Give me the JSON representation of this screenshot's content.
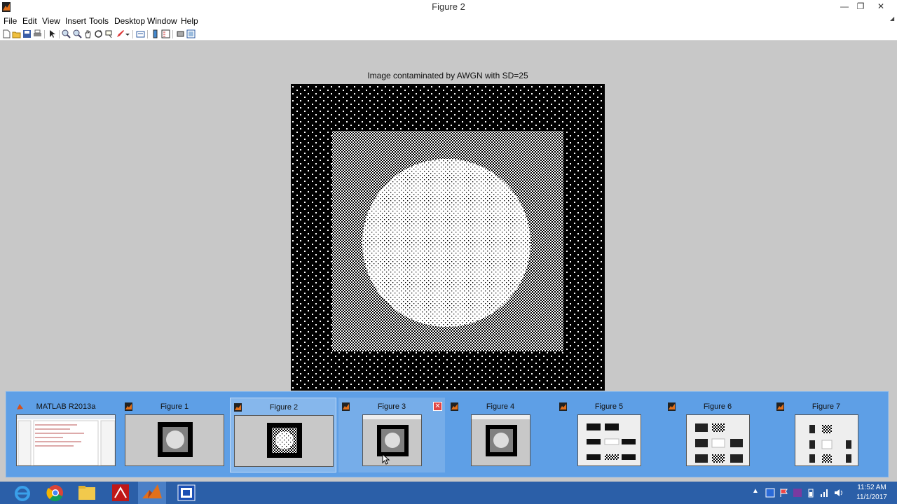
{
  "window": {
    "title": "Figure 2",
    "controls": {
      "minimize": "—",
      "maximize": "❐",
      "close": "✕"
    }
  },
  "menu": {
    "items": [
      "File",
      "Edit",
      "View",
      "Insert",
      "Tools",
      "Desktop",
      "Window",
      "Help"
    ],
    "collapse": "◢"
  },
  "toolbar": {
    "buttons": [
      "new-figure-icon",
      "open-file-icon",
      "save-icon",
      "print-icon",
      "edit-plot-icon",
      "zoom-in-icon",
      "zoom-out-icon",
      "pan-icon",
      "rotate-3d-icon",
      "data-cursor-icon",
      "brush-icon",
      "link-plot-icon",
      "colorbar-icon",
      "legend-icon",
      "hide-plot-tools-icon",
      "show-plot-tools-icon"
    ]
  },
  "plot": {
    "title": "Image contaminated by AWGN with SD=25"
  },
  "thumbnails": [
    {
      "label": "MATLAB R2013a",
      "icon": "matlab-logo-icon",
      "kind": "desktop"
    },
    {
      "label": "Figure 1",
      "icon": "matlab-figure-icon",
      "kind": "clean"
    },
    {
      "label": "Figure 2",
      "icon": "matlab-figure-icon",
      "kind": "noisy",
      "state": "selected"
    },
    {
      "label": "Figure 3",
      "icon": "matlab-figure-icon",
      "kind": "clean-titled",
      "state": "hovered",
      "close": "✕"
    },
    {
      "label": "Figure 4",
      "icon": "matlab-figure-icon",
      "kind": "clean-titled"
    },
    {
      "label": "Figure 5",
      "icon": "matlab-figure-icon",
      "kind": "grid"
    },
    {
      "label": "Figure 6",
      "icon": "matlab-figure-icon",
      "kind": "grid"
    },
    {
      "label": "Figure 7",
      "icon": "matlab-figure-icon",
      "kind": "grid"
    }
  ],
  "taskbar": {
    "apps": [
      "internet-explorer-icon",
      "chrome-icon",
      "file-explorer-icon",
      "acrobat-icon",
      "matlab-icon",
      "remote-app-icon"
    ],
    "active_app": "matlab-icon",
    "tray": [
      "show-hidden-icons-arrow",
      "network-app-icon",
      "flag-icon",
      "security-icon",
      "battery-icon",
      "signal-icon",
      "volume-icon"
    ],
    "tray_arrow": "▲",
    "time": "11:52 AM",
    "date": "11/1/2017"
  },
  "colors": {
    "taskbar": "#2b5fa8",
    "thumb_panel": "#5e9fe6",
    "figure_bg": "#c8c8c8"
  }
}
